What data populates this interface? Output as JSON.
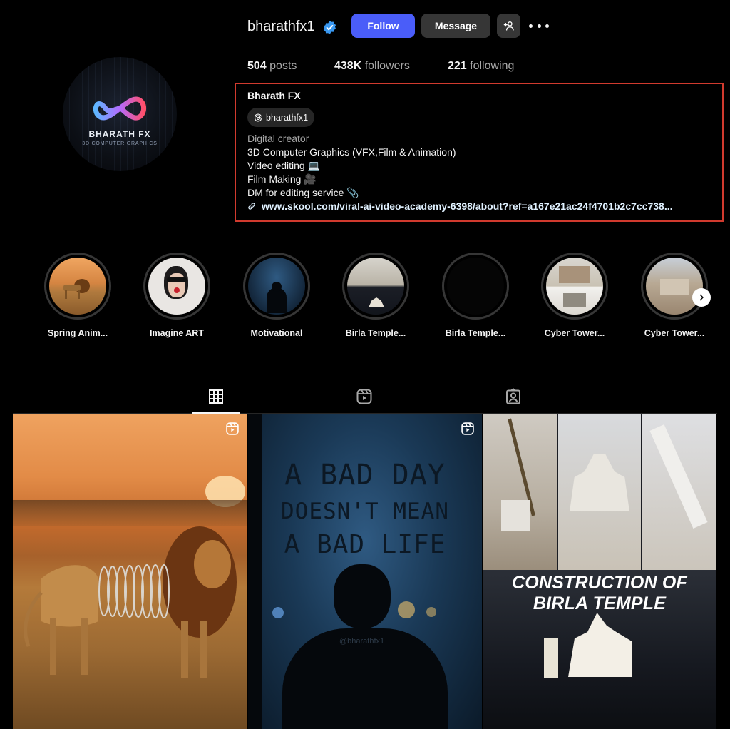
{
  "profile": {
    "username": "bharathfx1",
    "verified": true,
    "buttons": {
      "follow": "Follow",
      "message": "Message"
    },
    "avatar": {
      "brand": "BHARATH FX",
      "tagline": "3D COMPUTER GRAPHICS"
    },
    "stats": [
      {
        "value": "504",
        "label": "posts"
      },
      {
        "value": "438K",
        "label": "followers"
      },
      {
        "value": "221",
        "label": "following"
      }
    ]
  },
  "bio": {
    "name": "Bharath FX",
    "threads_handle": "bharathfx1",
    "category": "Digital creator",
    "lines": [
      "3D Computer Graphics (VFX,Film & Animation)",
      "Video editing 💻",
      "Film Making 🎥",
      "DM for editing service 📎"
    ],
    "link": "www.skool.com/viral-ai-video-academy-6398/about?ref=a167e21ac24f4701b2c7cc738..."
  },
  "highlights": [
    {
      "label": "Spring Anim..."
    },
    {
      "label": "Imagine ART"
    },
    {
      "label": "Motivational"
    },
    {
      "label": "Birla Temple..."
    },
    {
      "label": "Birla Temple..."
    },
    {
      "label": "Cyber Tower..."
    },
    {
      "label": "Cyber Tower..."
    }
  ],
  "tabs": [
    {
      "icon": "grid-icon",
      "active": true
    },
    {
      "icon": "reels-icon",
      "active": false
    },
    {
      "icon": "tagged-icon",
      "active": false
    }
  ],
  "posts": [
    {
      "type": "reel",
      "subject": "lion-slinky"
    },
    {
      "type": "reel",
      "text_lines": [
        "A BAD DAY",
        "DOESN'T MEAN",
        "A BAD LIFE"
      ],
      "watermark": "@bharathfx1"
    },
    {
      "type": "image",
      "title": "CONSTRUCTION OF BIRLA TEMPLE"
    }
  ],
  "colors": {
    "accent": "#4a5df9",
    "highlight_box": "#d13a2e",
    "verified": "#3897f0"
  }
}
